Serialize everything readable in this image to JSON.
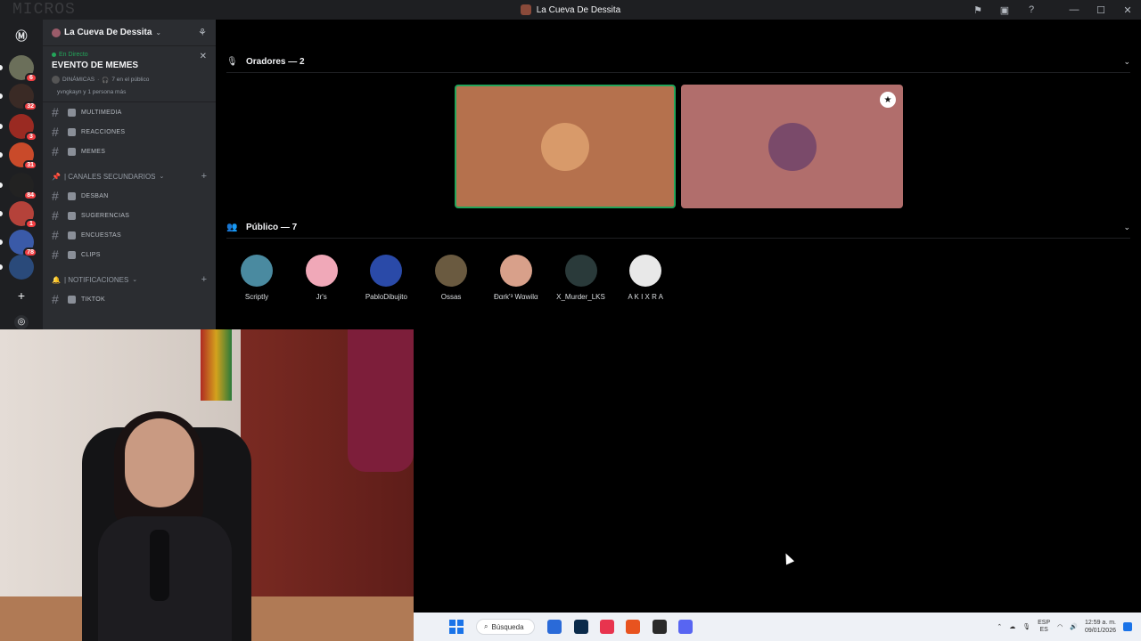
{
  "window": {
    "title": "La Cueva De Dessita",
    "ghost_text": "MICROS",
    "toolbar_icons": [
      "inbox-icon",
      "help-icon",
      "minimize-icon",
      "maximize-icon",
      "close-icon"
    ]
  },
  "rail": {
    "servers": [
      {
        "badge": "6",
        "color": "#6b6f5a"
      },
      {
        "badge": "32",
        "color": "#3a2a25"
      },
      {
        "badge": "3",
        "color": "#9a2a22"
      },
      {
        "badge": "31",
        "color": "#c94a2a"
      },
      {
        "badge": "84",
        "color": "#222222"
      },
      {
        "badge": "1",
        "color": "#b5423a"
      },
      {
        "badge": "78",
        "color": "#3a5aa8"
      },
      {
        "badge": "",
        "color": "#2a4a7a"
      }
    ]
  },
  "sidebar": {
    "server_name": "La Cueva De Dessita",
    "event": {
      "live_label": "En Directo",
      "title": "EVENTO DE MEMES",
      "meta_channel": "DINÁMICAS",
      "meta_audience": "7 en el público",
      "meta_people": "yvngkayn y 1 persona más"
    },
    "channels_top": [
      {
        "name": "MULTIMEDIA"
      },
      {
        "name": "REACCIONES"
      },
      {
        "name": "MEMES"
      }
    ],
    "category1": "| CANALES SECUNDARIOS",
    "channels_mid": [
      {
        "name": "DESBAN"
      },
      {
        "name": "SUGERENCIAS"
      },
      {
        "name": "ENCUESTAS"
      },
      {
        "name": "CLIPS"
      }
    ],
    "category2": "| NOTIFICACIONES",
    "channels_bottom": [
      {
        "name": "TIKTOK"
      }
    ]
  },
  "stage": {
    "speakers_label": "Oradores — 2",
    "audience_label": "Público — 7",
    "speakers": [
      {
        "tile_color": "#b5714d",
        "avatar_color": "#d89a6a"
      },
      {
        "tile_color": "#b16e6c",
        "avatar_color": "#7a4a6a"
      }
    ],
    "audience": [
      {
        "name": "Scriptly",
        "color": "#4a8aa0"
      },
      {
        "name": "Jr's",
        "color": "#f0a8b8"
      },
      {
        "name": "PabloDibujito",
        "color": "#2a4aa8"
      },
      {
        "name": "Ossas",
        "color": "#6a5a40"
      },
      {
        "name": "Ðαrk'³ Wαwilα",
        "color": "#d8a08a"
      },
      {
        "name": "X_Murder_LKS",
        "color": "#2a3a3a"
      },
      {
        "name": "A K I X R A",
        "color": "#e8e8e8"
      }
    ]
  },
  "taskbar": {
    "search_label": "Búsqueda",
    "lang_top": "ESP",
    "lang_bottom": "ES",
    "time": "12:59 a. m.",
    "date": "09/01/2026",
    "apps": [
      {
        "name": "file-explorer-icon",
        "color": "#2a6ad8"
      },
      {
        "name": "photoshop-icon",
        "color": "#0a2a4a"
      },
      {
        "name": "music-icon",
        "color": "#e8344e"
      },
      {
        "name": "brave-icon",
        "color": "#e8531f"
      },
      {
        "name": "obs-icon",
        "color": "#2a2a2a"
      },
      {
        "name": "discord-icon",
        "color": "#5865f2"
      }
    ]
  }
}
